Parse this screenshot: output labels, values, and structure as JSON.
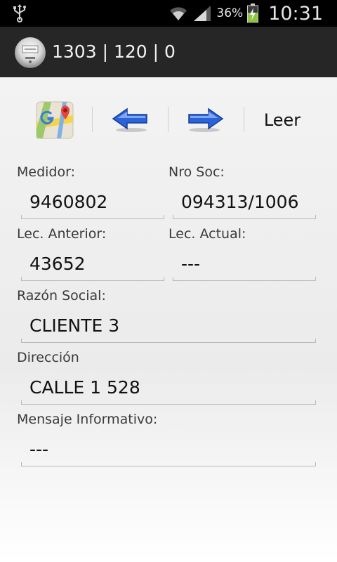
{
  "status_bar": {
    "battery_percent": "36%",
    "time": "10:31"
  },
  "action_bar": {
    "title": "1303 | 120 | 0"
  },
  "toolbar": {
    "maps_icon": "maps-icon",
    "prev_icon": "arrow-left-icon",
    "next_icon": "arrow-right-icon",
    "read_label": "Leer"
  },
  "form": {
    "medidor": {
      "label": "Medidor:",
      "value": "9460802"
    },
    "nro_soc": {
      "label": "Nro Soc:",
      "value": "094313/1006"
    },
    "lec_anterior": {
      "label": "Lec. Anterior:",
      "value": "43652"
    },
    "lec_actual": {
      "label": "Lec. Actual:",
      "value": "---"
    },
    "razon_social": {
      "label": "Razón Social:",
      "value": "CLIENTE 3"
    },
    "direccion": {
      "label": "Dirección",
      "value": "CALLE 1 528"
    },
    "mensaje": {
      "label": "Mensaje Informativo:",
      "value": "---"
    }
  }
}
